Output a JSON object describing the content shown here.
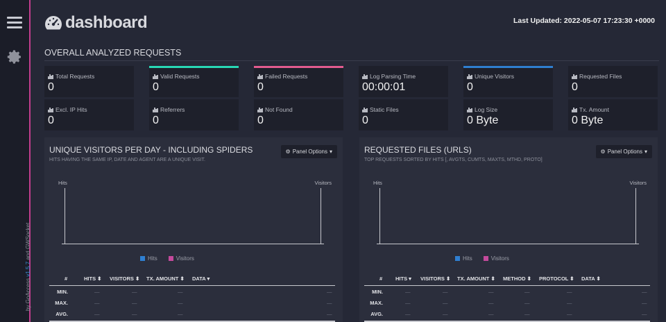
{
  "brand": {
    "name": "dashboard",
    "icon": "speedometer-icon"
  },
  "header": {
    "last_updated": "Last Updated: 2022-05-07 17:23:30 +0000"
  },
  "sidebar": {
    "menu_icon": "hamburger-icon",
    "settings_icon": "gear-icon",
    "credit_by": "by ",
    "credit_app": "GoAccess",
    "credit_version": " v1.5.7",
    "credit_rest": " and GWSocket"
  },
  "overall": {
    "title": "OVERALL ANALYZED REQUESTS",
    "cards": [
      {
        "label": "Total Requests",
        "value": "0",
        "accent": ""
      },
      {
        "label": "Valid Requests",
        "value": "0",
        "accent": "#28d9b5"
      },
      {
        "label": "Failed Requests",
        "value": "0",
        "accent": "#e35b8f"
      },
      {
        "label": "Log Parsing Time",
        "value": "00:00:01",
        "accent": ""
      },
      {
        "label": "Unique Visitors",
        "value": "0",
        "accent": "#2f7fd1"
      },
      {
        "label": "Requested Files",
        "value": "0",
        "accent": ""
      },
      {
        "label": "Excl. IP Hits",
        "value": "0",
        "accent": ""
      },
      {
        "label": "Referrers",
        "value": "0",
        "accent": ""
      },
      {
        "label": "Not Found",
        "value": "0",
        "accent": ""
      },
      {
        "label": "Static Files",
        "value": "0",
        "accent": ""
      },
      {
        "label": "Log Size",
        "value": "0 Byte",
        "accent": ""
      },
      {
        "label": "Tx. Amount",
        "value": "0 Byte",
        "accent": ""
      }
    ]
  },
  "panel_options_label": "Panel Options",
  "visitors_panel": {
    "title": "UNIQUE VISITORS PER DAY - INCLUDING SPIDERS",
    "subtitle": "HITS HAVING THE SAME IP, DATE AND AGENT ARE A UNIQUE VISIT.",
    "y_left": "Hits",
    "y_right": "Visitors",
    "legend": [
      "Hits",
      "Visitors"
    ],
    "columns": [
      "#",
      "HITS ⬍",
      "VISITORS ⬍",
      "TX. AMOUNT ⬍",
      "DATA ▾"
    ],
    "rows": [
      "MIN.",
      "MAX.",
      "AVG."
    ],
    "empty": "—"
  },
  "requests_panel": {
    "title": "REQUESTED FILES (URLS)",
    "subtitle": "TOP REQUESTS SORTED BY HITS [, AVGTS, CUMTS, MAXTS, MTHD, PROTO]",
    "y_left": "Hits",
    "y_right": "Visitors",
    "legend": [
      "Hits",
      "Visitors"
    ],
    "columns": [
      "#",
      "HITS ▾",
      "VISITORS ⬍",
      "TX. AMOUNT ⬍",
      "METHOD ⬍",
      "PROTOCOL ⬍",
      "DATA ⬍"
    ],
    "rows": [
      "MIN.",
      "MAX.",
      "AVG."
    ],
    "empty": "—"
  },
  "colors": {
    "hits": "#2f7fd1",
    "visitors": "#c44a9c",
    "sidebar_accent": "#c23d8e"
  }
}
